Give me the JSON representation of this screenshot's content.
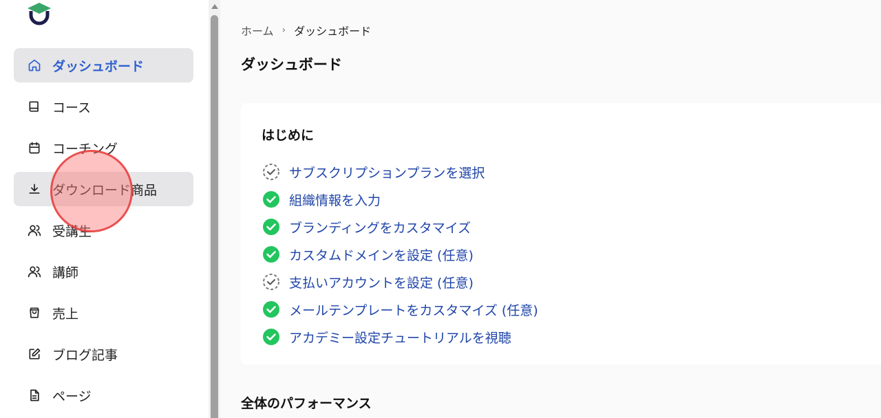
{
  "sidebar": {
    "items": [
      {
        "label": "ダッシュボード",
        "icon": "home-icon",
        "active": true
      },
      {
        "label": "コース",
        "icon": "book-icon"
      },
      {
        "label": "コーチング",
        "icon": "calendar-icon"
      },
      {
        "label": "ダウンロード商品",
        "icon": "download-icon",
        "hover": true
      },
      {
        "label": "受講生",
        "icon": "users-icon"
      },
      {
        "label": "講師",
        "icon": "users-icon"
      },
      {
        "label": "売上",
        "icon": "shopping-bag-icon"
      },
      {
        "label": "ブログ記事",
        "icon": "edit-icon"
      },
      {
        "label": "ページ",
        "icon": "file-text-icon"
      }
    ]
  },
  "breadcrumb": {
    "home": "ホーム",
    "current": "ダッシュボード"
  },
  "main": {
    "title": "ダッシュボード",
    "getting_started": {
      "title": "はじめに",
      "items": [
        {
          "label": "サブスクリプションプランを選択",
          "done": false
        },
        {
          "label": "組織情報を入力",
          "done": true
        },
        {
          "label": "ブランディングをカスタマイズ",
          "done": true
        },
        {
          "label": "カスタムドメインを設定 (任意)",
          "done": true
        },
        {
          "label": "支払いアカウントを設定 (任意)",
          "done": false
        },
        {
          "label": "メールテンプレートをカスタマイズ (任意)",
          "done": true
        },
        {
          "label": "アカデミー設定チュートリアルを視聴",
          "done": true
        }
      ]
    },
    "performance_title": "全体のパフォーマンス"
  },
  "colors": {
    "accent": "#2f5fd0",
    "link": "#1f45a8",
    "check_done": "#22c55e",
    "logo_green": "#3aa66a",
    "logo_navy": "#1c1f4a"
  }
}
